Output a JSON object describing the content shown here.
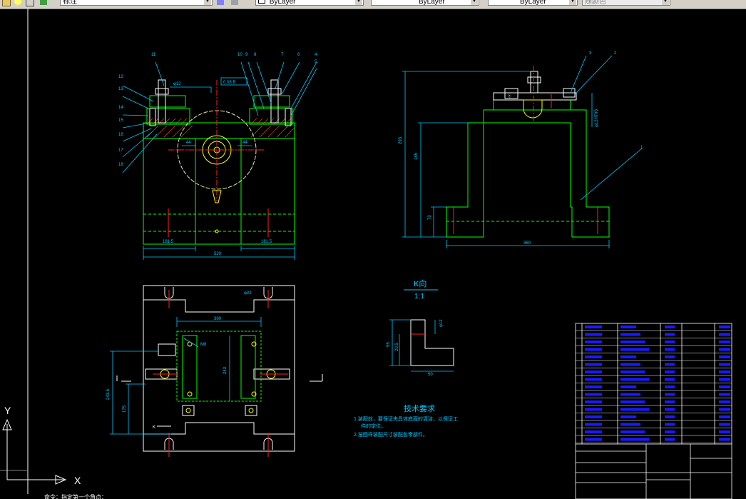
{
  "toolbar": {
    "style_value": "标注",
    "layer_color": "ByLayer",
    "layer_linetype": "ByLayer",
    "layer_lineweight": "ByLayer",
    "plot_style": "随颜色",
    "icons": [
      "folder-icon",
      "lightbulb-icon",
      "layer-icon",
      "match-properties-icon",
      "layer-previous-icon"
    ]
  },
  "colors": {
    "background": "#000000",
    "part": "#00ff00",
    "dimension": "#00c8ff",
    "center": "#ff2020",
    "edge": "#ffffff",
    "hatch": "#ff4040",
    "title_text": "#0000ff",
    "yellow": "#ffff00"
  },
  "front_view": {
    "balloons": [
      "11",
      "12",
      "13",
      "14",
      "15",
      "16",
      "17",
      "18",
      "10",
      "9",
      "8",
      "7",
      "6",
      "4",
      "5"
    ],
    "dim_left": "181.5",
    "dim_right": "181.5",
    "dim_total": "520",
    "dim_box": "0.03 B",
    "dim_phi": "φ12",
    "dim_44a": "44",
    "dim_44b": "44"
  },
  "side_view": {
    "balloons": [
      "3",
      "2",
      "1"
    ],
    "dim_height": "293",
    "dim_mid": "185",
    "dim_low": "70",
    "dim_width": "360",
    "dim_fit": "φ12H7/f6"
  },
  "top_view": {
    "dim_top": "300",
    "dim_height": "243",
    "dim_left_a": "243.5",
    "dim_left_b": "175",
    "note_a": "φ22",
    "note_b": "M8",
    "section_marker": "K"
  },
  "k_view": {
    "title": "K向",
    "scale": "1:1",
    "dim_h": "55",
    "dim_h2": "20.5",
    "dim_w": "50",
    "dim_phi": "φ12"
  },
  "notes": {
    "title": "技术要求",
    "line1": "1.装配前，要保证夹具体底面的清洁，以保证工",
    "line1b": "件的定位。",
    "line2": "2.按图样装配尺寸装配各零部件。"
  },
  "axis": {
    "x_label": "X",
    "y_label": "Y"
  },
  "command_line": {
    "text": "命令：指定第一个角点："
  }
}
